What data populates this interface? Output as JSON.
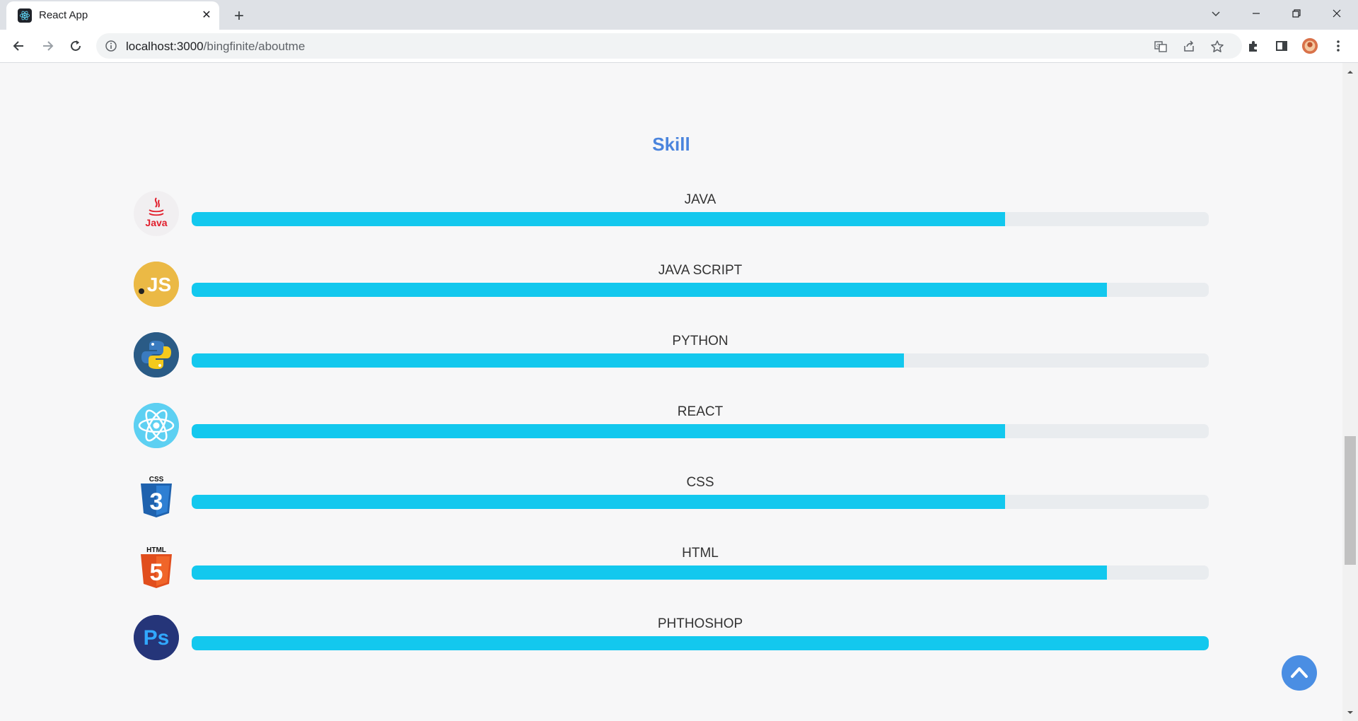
{
  "browser": {
    "tab_title": "React App",
    "tab_close": "✕",
    "new_tab": "+",
    "url_host": "localhost:3000",
    "url_path": "/bingfinite/aboutme"
  },
  "page": {
    "section_title": "Skill",
    "skills": [
      {
        "name": "JAVA",
        "level": 0.8,
        "icon": "java-icon"
      },
      {
        "name": "JAVA SCRIPT",
        "level": 0.9,
        "icon": "javascript-icon"
      },
      {
        "name": "PYTHON",
        "level": 0.7,
        "icon": "python-icon"
      },
      {
        "name": "REACT",
        "level": 0.8,
        "icon": "react-icon"
      },
      {
        "name": "CSS",
        "level": 0.8,
        "icon": "css3-icon"
      },
      {
        "name": "HTML",
        "level": 0.9,
        "icon": "html5-icon"
      },
      {
        "name": "PHTHOSHOP",
        "level": 1.0,
        "icon": "photoshop-icon"
      }
    ],
    "css_badge_text": "CSS",
    "html_badge_text": "HTML",
    "css_number": "3",
    "html_number": "5",
    "java_logo_text": "Java",
    "js_logo_text": "JS",
    "ps_logo_text": "Ps"
  },
  "colors": {
    "title": "#4a84dd",
    "bar_fill": "#13c8ee",
    "bar_track": "#e9ecef",
    "scroll_button": "#4a8ee3"
  }
}
